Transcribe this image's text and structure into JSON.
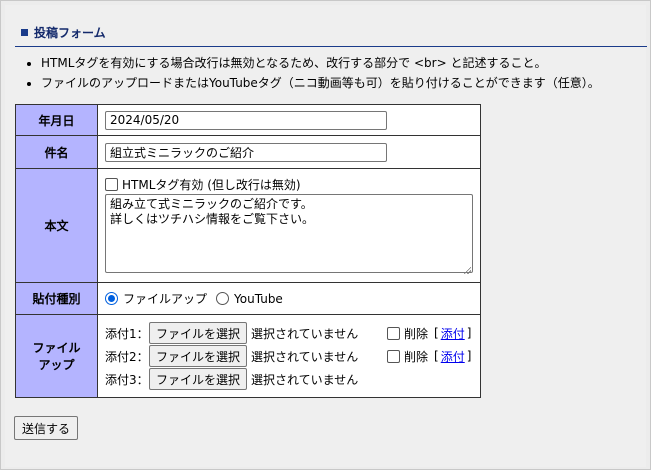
{
  "section_title": "投稿フォーム",
  "notes": [
    "HTMLタグを有効にする場合改行は無効となるため、改行する部分で <br> と記述すること。",
    "ファイルのアップロードまたはYouTubeタグ（ニコ動画等も可）を貼り付けることができます（任意）。"
  ],
  "form": {
    "date": {
      "label": "年月日",
      "value": "2024/05/20"
    },
    "subject": {
      "label": "件名",
      "value": "組立式ミニラックのご紹介"
    },
    "body": {
      "label": "本文",
      "html_toggle_label": "HTMLタグ有効 (但し改行は無効)",
      "html_toggle_checked": false,
      "value": "組み立て式ミニラックのご紹介です。\n詳しくはツチハシ情報をご覧下さい。"
    },
    "attach_type": {
      "label": "貼付種別",
      "options": [
        "ファイルアップ",
        "YouTube"
      ],
      "selected": "ファイルアップ"
    },
    "files": {
      "label_line1": "ファイル",
      "label_line2": "アップ",
      "items": [
        {
          "label": "添付1：",
          "button": "ファイルを選択",
          "status": "選択されていません",
          "delete_label": "削除",
          "link_prefix": "[",
          "link_text": "添付",
          "link_suffix": "]"
        },
        {
          "label": "添付2：",
          "button": "ファイルを選択",
          "status": "選択されていません",
          "delete_label": "削除",
          "link_prefix": "[",
          "link_text": "添付",
          "link_suffix": "]"
        },
        {
          "label": "添付3：",
          "button": "ファイルを選択",
          "status": "選択されていません"
        }
      ]
    }
  },
  "submit_label": "送信する"
}
